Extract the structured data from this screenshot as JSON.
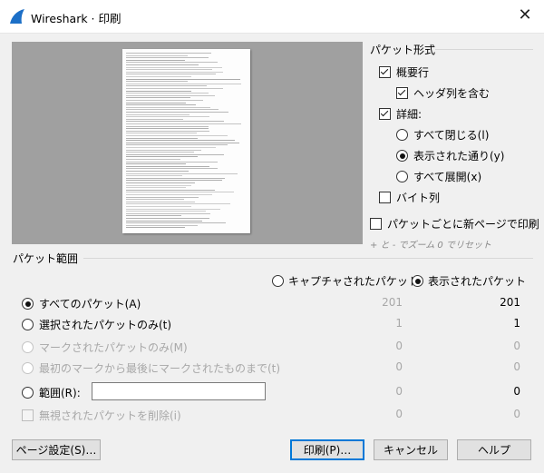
{
  "window": {
    "title": "Wireshark · 印刷"
  },
  "packet_format": {
    "header": "パケット形式",
    "summary": {
      "label": "概要行",
      "checked": true
    },
    "include_header": {
      "label": "ヘッダ列を含む",
      "checked": true
    },
    "details": {
      "label": "詳細:",
      "checked": true
    },
    "collapse_all": {
      "label": "すべて閉じる(l)"
    },
    "as_displayed": {
      "label": "表示された通り(y)"
    },
    "expand_all": {
      "label": "すべて展開(x)"
    },
    "bytes": {
      "label": "バイト列",
      "checked": false
    },
    "new_page": {
      "label": "パケットごとに新ページで印刷",
      "checked": false
    },
    "zoom_hint": "+ と - でズーム 0 でリセット"
  },
  "packet_range": {
    "header": "パケット範囲",
    "captured_label": "キャプチャされたパケット",
    "displayed_label": "表示されたパケット",
    "rows": [
      {
        "label": "すべてのパケット(A)",
        "captured": "201",
        "displayed": "201"
      },
      {
        "label": "選択されたパケットのみ(t)",
        "captured": "1",
        "displayed": "1"
      },
      {
        "label": "マークされたパケットのみ(M)",
        "captured": "0",
        "displayed": "0"
      },
      {
        "label": "最初のマークから最後にマークされたものまで(t)",
        "captured": "0",
        "displayed": "0"
      },
      {
        "label": "範囲(R):",
        "captured": "0",
        "displayed": "0"
      },
      {
        "label": "無視されたパケットを削除(i)",
        "captured": "0",
        "displayed": "0"
      }
    ],
    "range_value": ""
  },
  "buttons": {
    "page_setup": "ページ設定(S)…",
    "print": "印刷(P)…",
    "cancel": "キャンセル",
    "help": "ヘルプ"
  },
  "colors": {
    "accent": "#0078d7",
    "preview_bg": "#a0a0a0",
    "disabled_text": "#a8a8a8"
  }
}
